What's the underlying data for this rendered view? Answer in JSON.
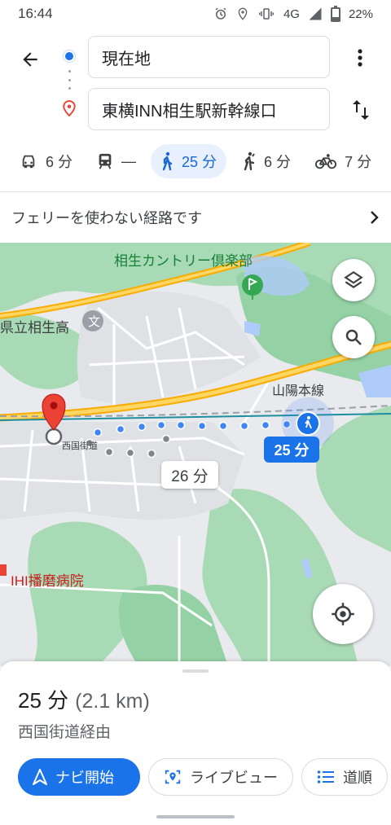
{
  "status": {
    "time": "16:44",
    "network": "4G",
    "battery": "22%"
  },
  "search": {
    "origin": "現在地",
    "destination": "東横INN相生駅新幹線口"
  },
  "modes": [
    {
      "icon": "car-icon",
      "label": "6 分",
      "active": false
    },
    {
      "icon": "transit-icon",
      "label": "—",
      "active": false
    },
    {
      "icon": "walk-icon",
      "label": "25 分",
      "active": true
    },
    {
      "icon": "ride-icon",
      "label": "6 分",
      "active": false
    },
    {
      "icon": "bike-icon",
      "label": "7 分",
      "active": false
    }
  ],
  "notice": {
    "text": "フェリーを使わない経路です"
  },
  "map": {
    "labels": {
      "golf": "相生カントリー倶楽部",
      "school": "県立相生高",
      "rail": "山陽本線",
      "street": "西国街道",
      "hospital": "IHI播磨病院"
    },
    "route_time": "25 分",
    "alt_time": "26 分"
  },
  "sheet": {
    "duration": "25 分",
    "distance": "(2.1 km)",
    "via": "西国街道経由",
    "buttons": {
      "navigate": "ナビ開始",
      "liveview": "ライブビュー",
      "steps": "道順"
    }
  },
  "colors": {
    "accent": "#1a73e8",
    "pin": "#ea4335",
    "route": "#4285f4"
  }
}
